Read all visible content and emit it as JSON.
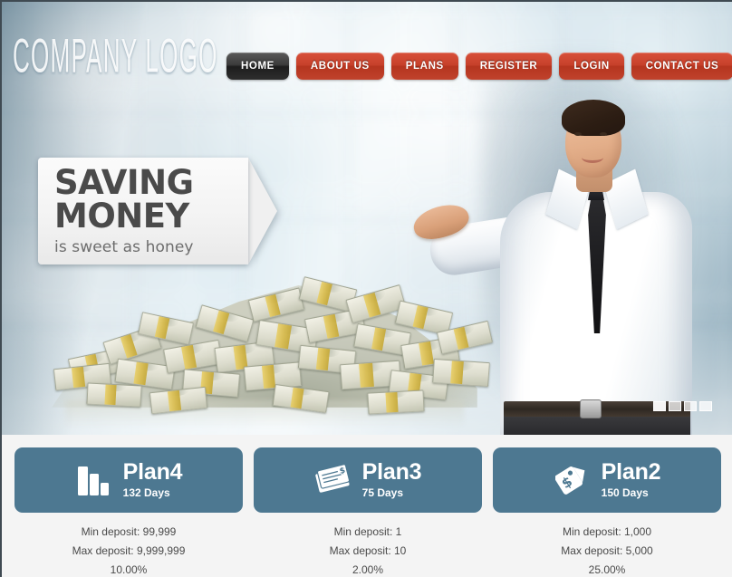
{
  "site": {
    "logo_text": "COMPANY LOGO"
  },
  "nav": {
    "items": [
      {
        "label": "HOME",
        "active": true
      },
      {
        "label": "ABOUT US",
        "active": false
      },
      {
        "label": "PLANS",
        "active": false
      },
      {
        "label": "REGISTER",
        "active": false
      },
      {
        "label": "LOGIN",
        "active": false
      },
      {
        "label": "CONTACT US",
        "active": false
      }
    ],
    "active_bg": "#1d1d1d",
    "bg": "#c0392b"
  },
  "hero": {
    "banner": {
      "line1": "SAVING",
      "line2": "MONEY",
      "line3": "is sweet as honey"
    },
    "slider": {
      "dots": 4,
      "active_index": 0
    },
    "image_alt": "businessman-with-money-pile"
  },
  "plans": {
    "cards": [
      {
        "name": "Plan4",
        "days": "132 Days",
        "icon": "bar-chart-icon",
        "min_deposit": "Min deposit: 99,999",
        "max_deposit": "Max deposit: 9,999,999",
        "percent": "10.00%"
      },
      {
        "name": "Plan3",
        "days": "75 Days",
        "icon": "cheque-icon",
        "min_deposit": "Min deposit: 1",
        "max_deposit": "Max deposit: 10",
        "percent": "2.00%"
      },
      {
        "name": "Plan2",
        "days": "150 Days",
        "icon": "price-tag-icon",
        "min_deposit": "Min deposit: 1,000",
        "max_deposit": "Max deposit: 5,000",
        "percent": "25.00%"
      }
    ],
    "card_color": "#4d7891",
    "text_color": "#4a4a4a"
  }
}
